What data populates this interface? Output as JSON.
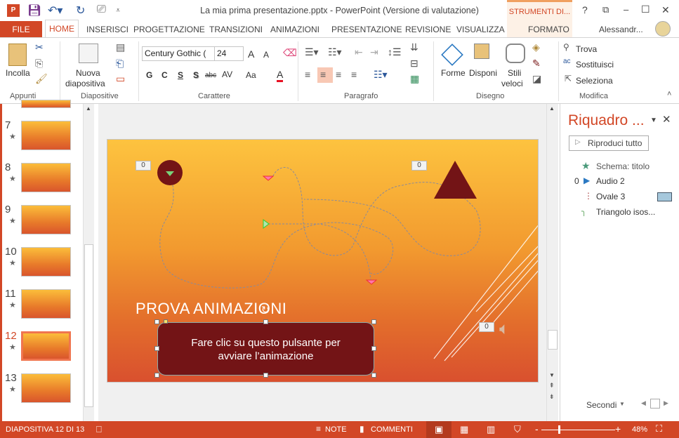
{
  "window": {
    "title": "La mia prima presentazione.pptx - PowerPoint (Versione di valutazione)",
    "context_tools": "STRUMENTI DI...",
    "help": "?",
    "min": "–",
    "max": "☐",
    "close": "✕",
    "restore": "⧉"
  },
  "ribbon_tabs": {
    "file": "FILE",
    "home": "HOME",
    "items": [
      "INSERISCI",
      "PROGETTAZIONE",
      "TRANSIZIONI",
      "ANIMAZIONI",
      "PRESENTAZIONE",
      "REVISIONE",
      "VISUALIZZA"
    ],
    "formato": "FORMATO",
    "user": "Alessandr..."
  },
  "ribbon": {
    "clipboard": {
      "paste": "Incolla",
      "group": "Appunti"
    },
    "slides": {
      "new_slide_1": "Nuova",
      "new_slide_2": "diapositiva",
      "group": "Diapositive"
    },
    "font": {
      "name": "Century Gothic (",
      "size": "24",
      "bold": "G",
      "italic": "C",
      "underline": "S",
      "shadow": "S",
      "strike": "abc",
      "spacing": "AV",
      "case": "Aa",
      "color": "A",
      "grow": "A",
      "shrink": "A",
      "group": "Carattere"
    },
    "paragraph": {
      "group": "Paragrafo"
    },
    "drawing": {
      "shapes": "Forme",
      "arrange": "Disponi",
      "styles_1": "Stili",
      "styles_2": "veloci",
      "group": "Disegno"
    },
    "editing": {
      "find": "Trova",
      "replace": "Sostituisci",
      "select": "Seleziona",
      "group": "Modifica"
    }
  },
  "slides": [
    {
      "num": "7"
    },
    {
      "num": "8"
    },
    {
      "num": "9"
    },
    {
      "num": "10"
    },
    {
      "num": "11"
    },
    {
      "num": "12",
      "selected": true
    },
    {
      "num": "13"
    }
  ],
  "slide": {
    "title": "PROVA ANIMAZIONI",
    "button_text": "Fare clic su questo pulsante per avviare l’animazione",
    "badges": [
      "0",
      "0",
      "0"
    ],
    "colors": {
      "shape": "#731416",
      "accent": "#d24726"
    }
  },
  "pane": {
    "title": "Riquadro ...",
    "play_all": "Riproduci tutto",
    "items": [
      {
        "order": "",
        "label": "Schema: titolo"
      },
      {
        "order": "0",
        "label": "Audio 2"
      },
      {
        "order": "",
        "label": "Ovale 3"
      },
      {
        "order": "",
        "label": "Triangolo isos..."
      }
    ],
    "seconds": "Secondi"
  },
  "status": {
    "slide": "DIAPOSITIVA 12 DI 13",
    "notes": "NOTE",
    "comments": "COMMENTI",
    "zoom": "48%",
    "zoom_percent": 48
  }
}
